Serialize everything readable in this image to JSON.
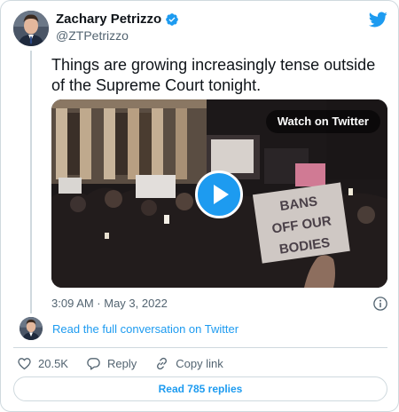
{
  "author": {
    "name": "Zachary Petrizzo",
    "handle": "@ZTPetrizzo"
  },
  "tweet": {
    "text": "Things are growing increasingly tense outside of the Supreme Court tonight.",
    "timestamp": "3:09 AM · May 3, 2022"
  },
  "media": {
    "watch_label": "Watch on Twitter",
    "sign_text": [
      "BANS",
      "OFF OUR",
      "BODIES"
    ]
  },
  "conversation": {
    "link_text": "Read the full conversation on Twitter"
  },
  "actions": {
    "likes": "20.5K",
    "reply_label": "Reply",
    "copy_link_label": "Copy link"
  },
  "replies_button": "Read 785 replies",
  "colors": {
    "accent": "#1d9bf0",
    "text_secondary": "#536471",
    "border": "#cfd9de"
  },
  "icons": [
    "twitter-bird-icon",
    "verified-badge-icon",
    "play-icon",
    "info-icon",
    "heart-icon",
    "reply-bubble-icon",
    "link-icon"
  ]
}
